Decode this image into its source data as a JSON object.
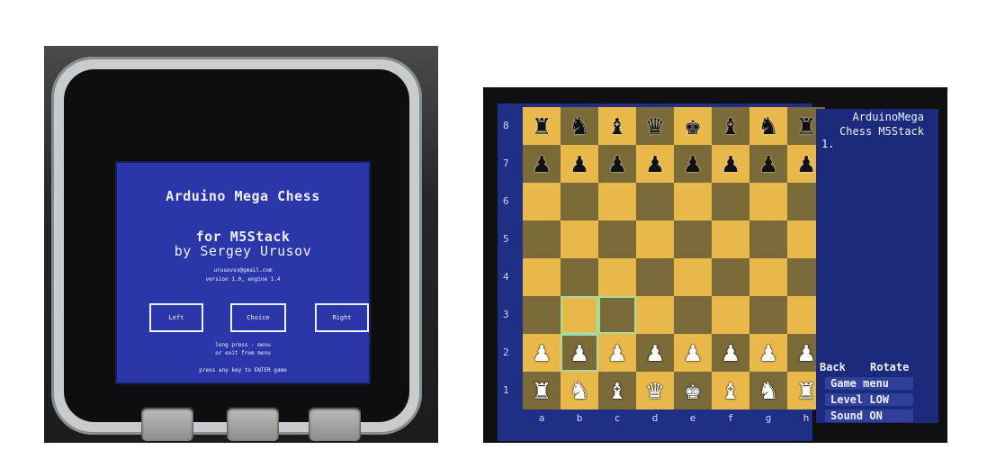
{
  "device_photo": {
    "screen": {
      "title_line1": "Arduino Mega Chess",
      "title_line2": "for M5Stack",
      "author": "by Sergey Urusov",
      "email": "urusovsv@gmail.com",
      "version": "version 1.0, engine 1.4",
      "buttons": {
        "left": "Left",
        "choice": "Choice",
        "right": "Right"
      },
      "hint_line1": "long press - menu",
      "hint_line2": "or exit from menu",
      "press_text": "press any key to ENTER game"
    }
  },
  "chess_photo": {
    "panel": {
      "heading_line1": "ArduinoMega",
      "heading_line2": "Chess M5Stack",
      "moves": "1.",
      "back": "Back",
      "rotate": "Rotate",
      "menu_items": [
        "Game menu",
        "Level LOW",
        "Sound ON"
      ]
    },
    "ranks": [
      "8",
      "7",
      "6",
      "5",
      "4",
      "3",
      "2",
      "1"
    ],
    "files": [
      "a",
      "b",
      "c",
      "d",
      "e",
      "f",
      "g",
      "h"
    ],
    "board": [
      [
        "bR",
        "bN",
        "bB",
        "bQ",
        "bK",
        "bB",
        "bN",
        "bR"
      ],
      [
        "bP",
        "bP",
        "bP",
        "bP",
        "bP",
        "bP",
        "bP",
        "bP"
      ],
      [
        "",
        "",
        "",
        "",
        "",
        "",
        "",
        ""
      ],
      [
        "",
        "",
        "",
        "",
        "",
        "",
        "",
        ""
      ],
      [
        "",
        "",
        "",
        "",
        "",
        "",
        "",
        ""
      ],
      [
        "",
        "",
        "",
        "",
        "",
        "",
        "",
        ""
      ],
      [
        "wP",
        "wP",
        "wP",
        "wP",
        "wP",
        "wP",
        "wP",
        "wP"
      ],
      [
        "wR",
        "wN",
        "wB",
        "wQ",
        "wK",
        "wB",
        "wN",
        "wR"
      ]
    ],
    "highlighted_squares": [
      "b3",
      "c3",
      "b2"
    ],
    "colors": {
      "light_square": "#e8b84a",
      "dark_square": "#7a6a38",
      "screen_blue": "#1f2f86"
    }
  }
}
